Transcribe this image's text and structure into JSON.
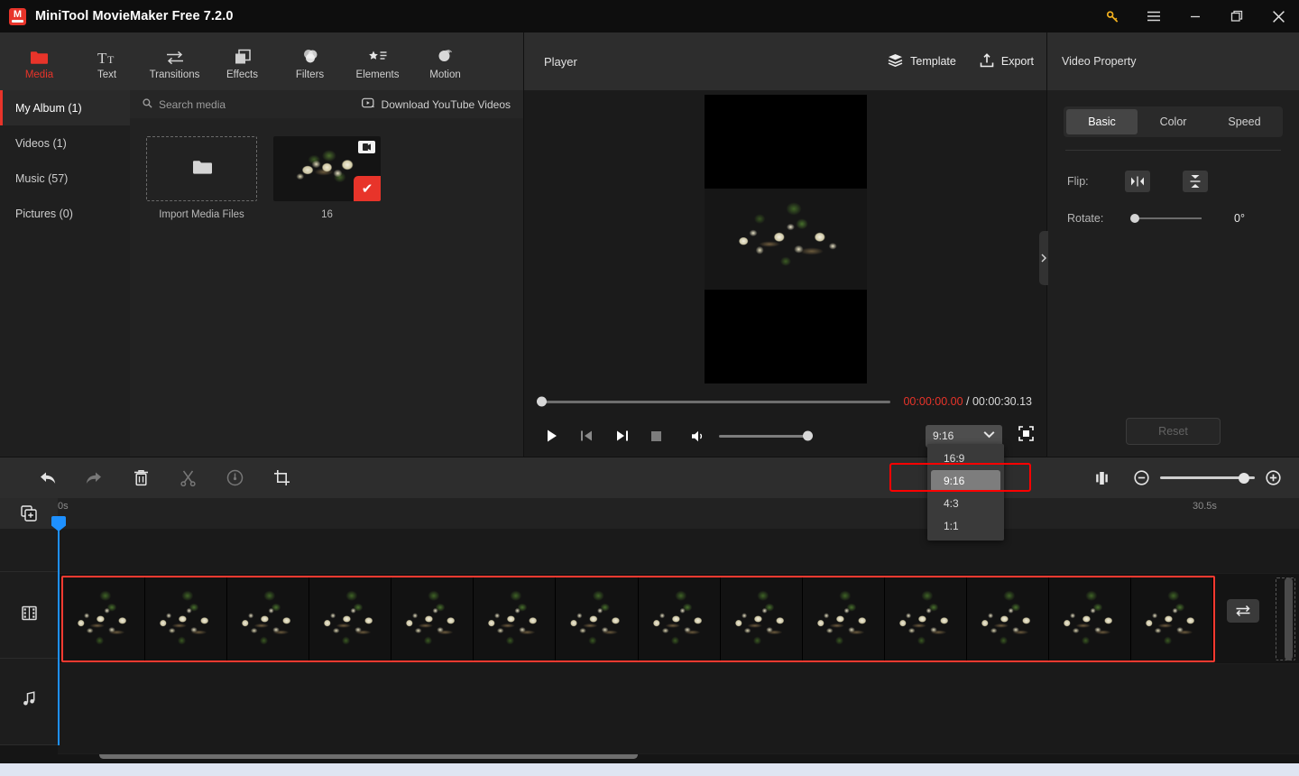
{
  "window": {
    "title": "MiniTool MovieMaker Free 7.2.0",
    "logo_letter": "M",
    "controls": {
      "key": "key-icon",
      "menu": "hamburger-menu-icon",
      "minimize": "minimize-icon",
      "maximize": "maximize-icon",
      "close": "close-icon"
    }
  },
  "ribbon": {
    "items": [
      {
        "label": "Media",
        "icon": "folder-icon",
        "active": true
      },
      {
        "label": "Text",
        "icon": "text-icon",
        "active": false
      },
      {
        "label": "Transitions",
        "icon": "transitions-icon",
        "active": false
      },
      {
        "label": "Effects",
        "icon": "effects-icon",
        "active": false
      },
      {
        "label": "Filters",
        "icon": "filters-icon",
        "active": false
      },
      {
        "label": "Elements",
        "icon": "elements-icon",
        "active": false
      },
      {
        "label": "Motion",
        "icon": "motion-icon",
        "active": false
      }
    ]
  },
  "library": {
    "categories": [
      {
        "label": "My Album (1)",
        "active": true
      },
      {
        "label": "Videos (1)",
        "active": false
      },
      {
        "label": "Music (57)",
        "active": false
      },
      {
        "label": "Pictures (0)",
        "active": false
      }
    ],
    "search_placeholder": "Search media",
    "download_youtube_label": "Download YouTube Videos",
    "import_label": "Import Media Files",
    "items": [
      {
        "name": "16",
        "type": "video",
        "selected": true
      }
    ]
  },
  "player": {
    "title": "Player",
    "template_label": "Template",
    "export_label": "Export",
    "current_time": "00:00:00.00",
    "separator": " / ",
    "total_time": "00:00:30.13",
    "aspect_ratio": "9:16",
    "aspect_options": [
      "16:9",
      "9:16",
      "4:3",
      "1:1"
    ],
    "selected_option": "9:16",
    "controls": {
      "play": "play-icon",
      "prev_frame": "previous-frame-icon",
      "next_frame": "next-frame-icon",
      "stop": "stop-icon",
      "volume": "volume-icon",
      "fullscreen": "fullscreen-icon"
    }
  },
  "property": {
    "title": "Video Property",
    "tabs": [
      {
        "label": "Basic",
        "active": true
      },
      {
        "label": "Color",
        "active": false
      },
      {
        "label": "Speed",
        "active": false
      }
    ],
    "flip_label": "Flip:",
    "flip_horizontal_icon": "flip-horizontal-icon",
    "flip_vertical_icon": "flip-vertical-icon",
    "rotate_label": "Rotate:",
    "rotate_value": "0°",
    "reset_label": "Reset"
  },
  "timeline": {
    "toolbar": [
      {
        "name": "undo",
        "icon": "undo-icon",
        "enabled": true
      },
      {
        "name": "redo",
        "icon": "redo-icon",
        "enabled": false
      },
      {
        "name": "delete",
        "icon": "trash-icon",
        "enabled": true
      },
      {
        "name": "split",
        "icon": "scissors-icon",
        "enabled": false
      },
      {
        "name": "speed",
        "icon": "speed-gauge-icon",
        "enabled": false
      },
      {
        "name": "crop",
        "icon": "crop-icon",
        "enabled": true
      }
    ],
    "fit_icon": "fit-to-timeline-icon",
    "zoom_out_icon": "zoom-out-icon",
    "zoom_in_icon": "zoom-in-icon",
    "add_track_icon": "add-track-icon",
    "ruler_start": "0s",
    "ruler_end": "30.5s",
    "tracks": [
      {
        "name": "text-track",
        "icon": ""
      },
      {
        "name": "video-track",
        "icon": "film-strip-icon"
      },
      {
        "name": "audio-track",
        "icon": "music-note-icon"
      }
    ],
    "clip": {
      "frame_count": 14,
      "selected": true
    },
    "swap_icon": "swap-arrows-icon"
  },
  "colors": {
    "accent_red": "#e8342a",
    "playhead_blue": "#1e90ff",
    "selection_red": "#ff3a30",
    "highlight_red": "#ff0000"
  }
}
